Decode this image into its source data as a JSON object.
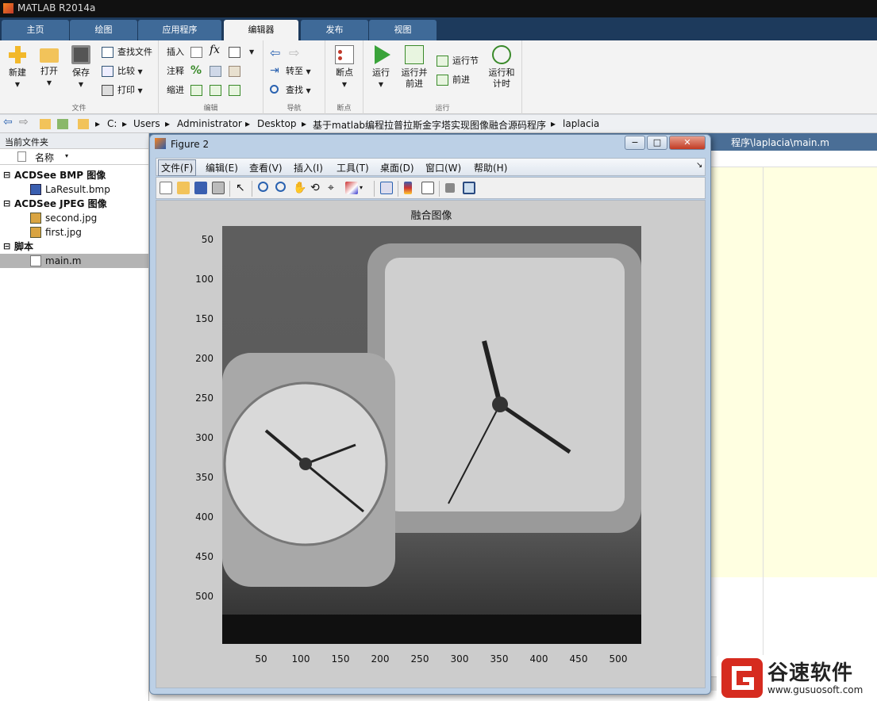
{
  "app": {
    "title": "MATLAB R2014a"
  },
  "tabs": [
    {
      "label": "主页"
    },
    {
      "label": "绘图"
    },
    {
      "label": "应用程序"
    },
    {
      "label": "编辑器",
      "active": true
    },
    {
      "label": "发布"
    },
    {
      "label": "视图"
    }
  ],
  "ribbon": {
    "file_group": {
      "label": "文件",
      "new": "新建",
      "open": "打开",
      "save": "保存",
      "find_files": "查找文件",
      "compare": "比较",
      "print": "打印"
    },
    "edit_group": {
      "label": "编辑",
      "insert": "插入",
      "comment": "注释",
      "indent": "缩进",
      "fx": "fx"
    },
    "nav_group": {
      "label": "导航",
      "goto": "转至",
      "find": "查找"
    },
    "breakpoint_group": {
      "label": "断点",
      "breakpoints": "断点"
    },
    "run_group": {
      "label": "运行",
      "run": "运行",
      "run_advance": "运行并\n前进",
      "run_section": "运行节",
      "advance": "前进",
      "run_time": "运行和\n计时"
    }
  },
  "address_bar": {
    "path": [
      "C:",
      "Users",
      "Administrator",
      "Desktop",
      "基于matlab编程拉普拉斯金字塔实现图像融合源码程序",
      "laplacia"
    ]
  },
  "current_folder": {
    "title": "当前文件夹",
    "column_header": "名称",
    "groups": [
      {
        "name": "ACDSee BMP 图像",
        "files": [
          {
            "name": "LaResult.bmp",
            "icon": "bmp-file-icon"
          }
        ]
      },
      {
        "name": "ACDSee JPEG 图像",
        "files": [
          {
            "name": "second.jpg",
            "icon": "jpg-file-icon"
          },
          {
            "name": "first.jpg",
            "icon": "jpg-file-icon"
          }
        ]
      },
      {
        "name": "脚本",
        "files": [
          {
            "name": "main.m",
            "icon": "m-file-icon",
            "selected": true
          }
        ]
      }
    ]
  },
  "editor": {
    "title_fragment": "程序\\laplacia\\main.m"
  },
  "figure": {
    "title": "Figure 2",
    "window_controls": [
      "−",
      "□",
      "✕"
    ],
    "menu": [
      {
        "label": "文件(F)"
      },
      {
        "label": "编辑(E)"
      },
      {
        "label": "查看(V)"
      },
      {
        "label": "插入(I)"
      },
      {
        "label": "工具(T)"
      },
      {
        "label": "桌面(D)"
      },
      {
        "label": "窗口(W)"
      },
      {
        "label": "帮助(H)"
      }
    ],
    "plot_title": "融合图像",
    "image_placeholder_description": "Grayscale fused photo of two alarm clocks (AT&T / BELL LABORATORIES and Ingraham)",
    "x_ticks": [
      "50",
      "100",
      "150",
      "200",
      "250",
      "300",
      "350",
      "400",
      "450",
      "500"
    ],
    "y_ticks": [
      "50",
      "100",
      "150",
      "200",
      "250",
      "300",
      "350",
      "400",
      "450",
      "500"
    ]
  },
  "watermark": {
    "name": "谷速软件",
    "url": "www.gusuosoft.com",
    "color": "#d62b1f"
  }
}
